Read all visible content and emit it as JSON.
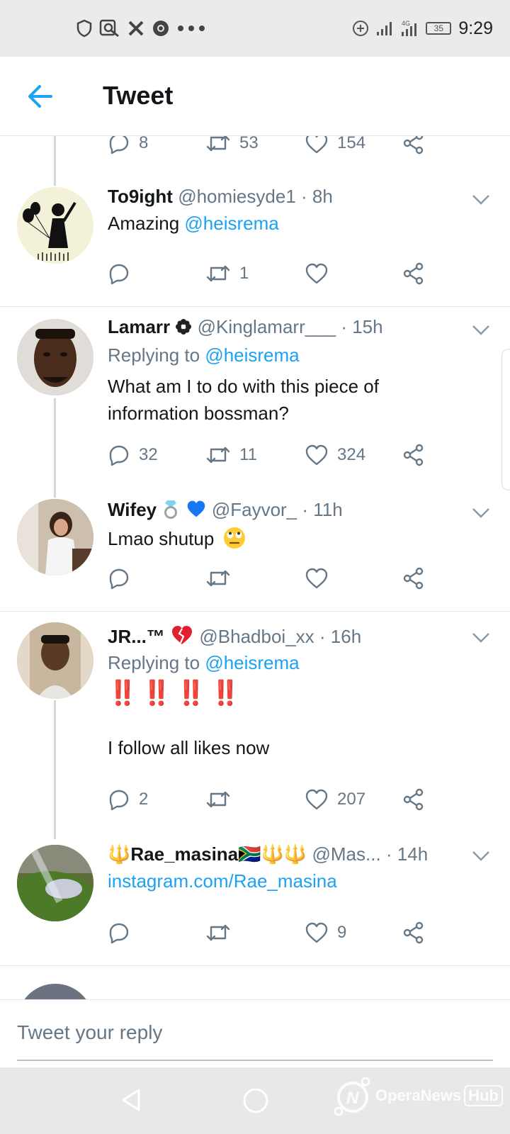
{
  "status_bar": {
    "time": "9:29",
    "battery": "35",
    "network": "4G"
  },
  "header": {
    "title": "Tweet"
  },
  "top_actions": {
    "reply": "8",
    "retweet": "53",
    "like": "154"
  },
  "tweets": [
    {
      "name": "To9ight",
      "handle": "@homiesyde1",
      "time": "· 8h",
      "text_prefix": "Amazing ",
      "text_mention": "@heisrema",
      "reply": "",
      "retweet": "1",
      "like": ""
    },
    {
      "name": "Lamarr",
      "handle": "@Kinglamarr___",
      "time": "· 15h",
      "replying_label": "Replying to ",
      "replying_to": "@heisrema",
      "text_line1": "What am I to do with this piece of",
      "text_line2": "information bossman?",
      "reply": "32",
      "retweet": "11",
      "like": "324"
    },
    {
      "name": "Wifey",
      "handle": "@Fayvor_",
      "time": "· 11h",
      "text": "Lmao shutup",
      "reply": "",
      "retweet": "",
      "like": ""
    },
    {
      "name": "JR...™",
      "handle": "@Bhadboi_xx",
      "time": "· 16h",
      "replying_label": "Replying to ",
      "replying_to": "@heisrema",
      "text_emphasis": "‼️‼️‼️‼️",
      "text": "I follow all likes now",
      "reply": "2",
      "retweet": "",
      "like": "207"
    },
    {
      "name": "🔱Rae_masina🇿🇦🔱🔱",
      "handle": "@Mas...",
      "time": "· 14h",
      "link": "instagram.com/Rae_masina",
      "reply": "",
      "retweet": "",
      "like": "9"
    }
  ],
  "reply_box": {
    "placeholder": "Tweet your reply"
  },
  "watermark": {
    "text": "OperaNews",
    "badge": "Hub"
  },
  "colors": {
    "accent": "#1da1f2",
    "muted": "#657786",
    "like_red": "#e0202d"
  }
}
